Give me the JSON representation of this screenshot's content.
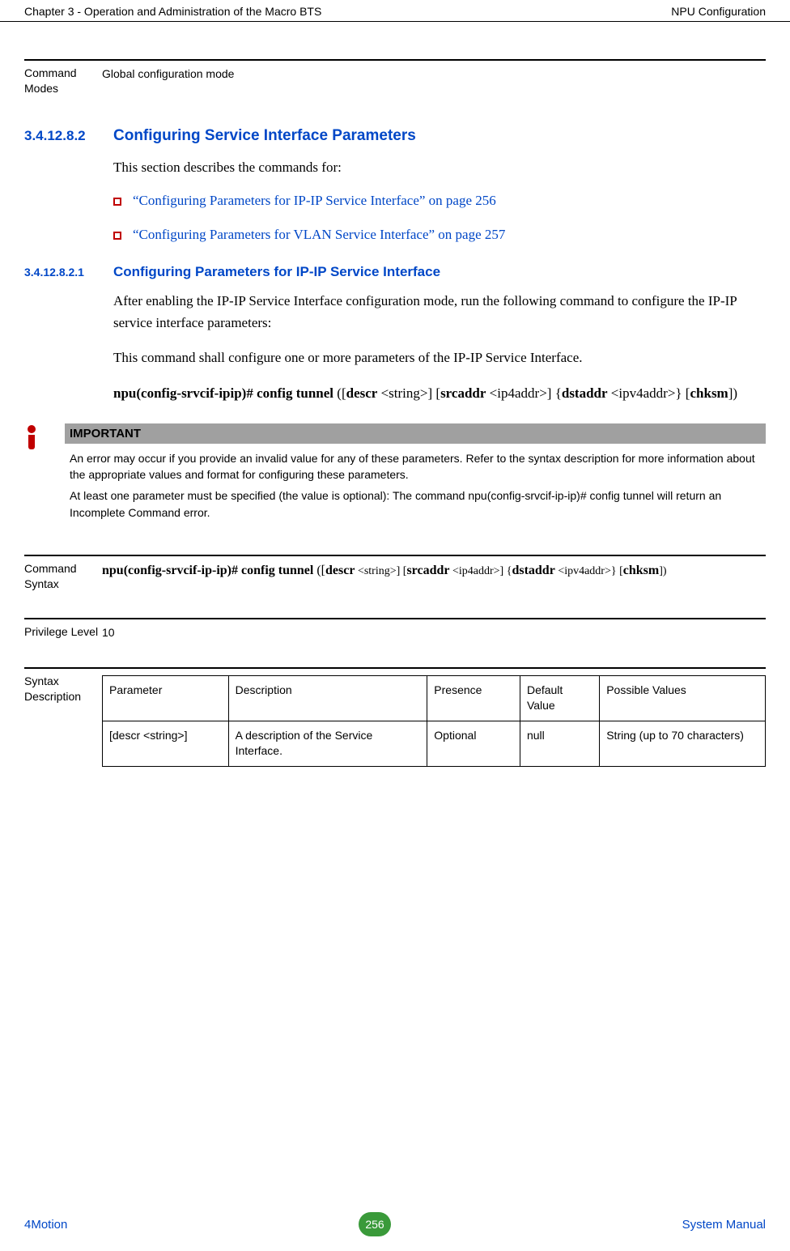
{
  "header": {
    "left": "Chapter 3 - Operation and Administration of the Macro BTS",
    "right": "NPU Configuration"
  },
  "cmdModes": {
    "label": "Command Modes",
    "value": "Global configuration mode"
  },
  "section": {
    "num": "3.4.12.8.2",
    "title": "Configuring Service Interface Parameters",
    "intro": "This section describes the commands for:",
    "bullets": [
      "“Configuring Parameters for IP-IP Service Interface” on page 256",
      "“Configuring Parameters for VLAN Service Interface” on page 257"
    ]
  },
  "subsection": {
    "num": "3.4.12.8.2.1",
    "title": "Configuring Parameters for IP-IP Service Interface",
    "para1": "After enabling the IP-IP Service Interface configuration mode, run the following command to configure the IP-IP service interface parameters:",
    "para2": "This command shall configure one or more parameters of the IP-IP Service Interface.",
    "cmdPrefix": "npu(config-srvcif-ipip)# config tunnel",
    "cmdArgs": {
      "descr": "descr",
      "descrArg": " <string>] [",
      "srcaddr": "srcaddr",
      "srcaddrArg": " <ip4addr>] {",
      "dstaddr": "dstaddr",
      "dstaddrArg": " <ipv4addr>} [",
      "chksm": "chksm",
      "close": "])"
    }
  },
  "important": {
    "title": "IMPORTANT",
    "p1": "An error may occur if you provide an invalid value for any of these parameters. Refer to the syntax description for more information about the appropriate values and format for configuring these parameters.",
    "p2": "At least one parameter must be specified (the value is optional): The command npu(config-srvcif-ip-ip)# config tunnel will return an Incomplete Command error."
  },
  "cmdSyntax": {
    "label": "Command Syntax",
    "prefix": "npu(config-srvcif-ip-ip)# config tunnel",
    "descr": "descr",
    "descrArg": " <string>] [",
    "srcaddr": "srcaddr",
    "srcaddrArg": " <ip4addr>] {",
    "dstaddr": "dstaddr",
    "dstaddrArg": " <ipv4addr>} [",
    "chksm": "chksm",
    "close": "])"
  },
  "privLevel": {
    "label": "Privilege Level",
    "value": "10"
  },
  "syntaxDesc": {
    "label": "Syntax Description",
    "headers": {
      "param": "Parameter",
      "desc": "Description",
      "presence": "Presence",
      "default": "Default Value",
      "possible": "Possible Values"
    },
    "rows": [
      {
        "param": "[descr <string>]",
        "desc": "A description of the Service Interface.",
        "presence": "Optional",
        "default": "null",
        "possible": "String (up to 70 characters)"
      }
    ]
  },
  "footer": {
    "left": "4Motion",
    "page": "256",
    "right": "System Manual"
  }
}
